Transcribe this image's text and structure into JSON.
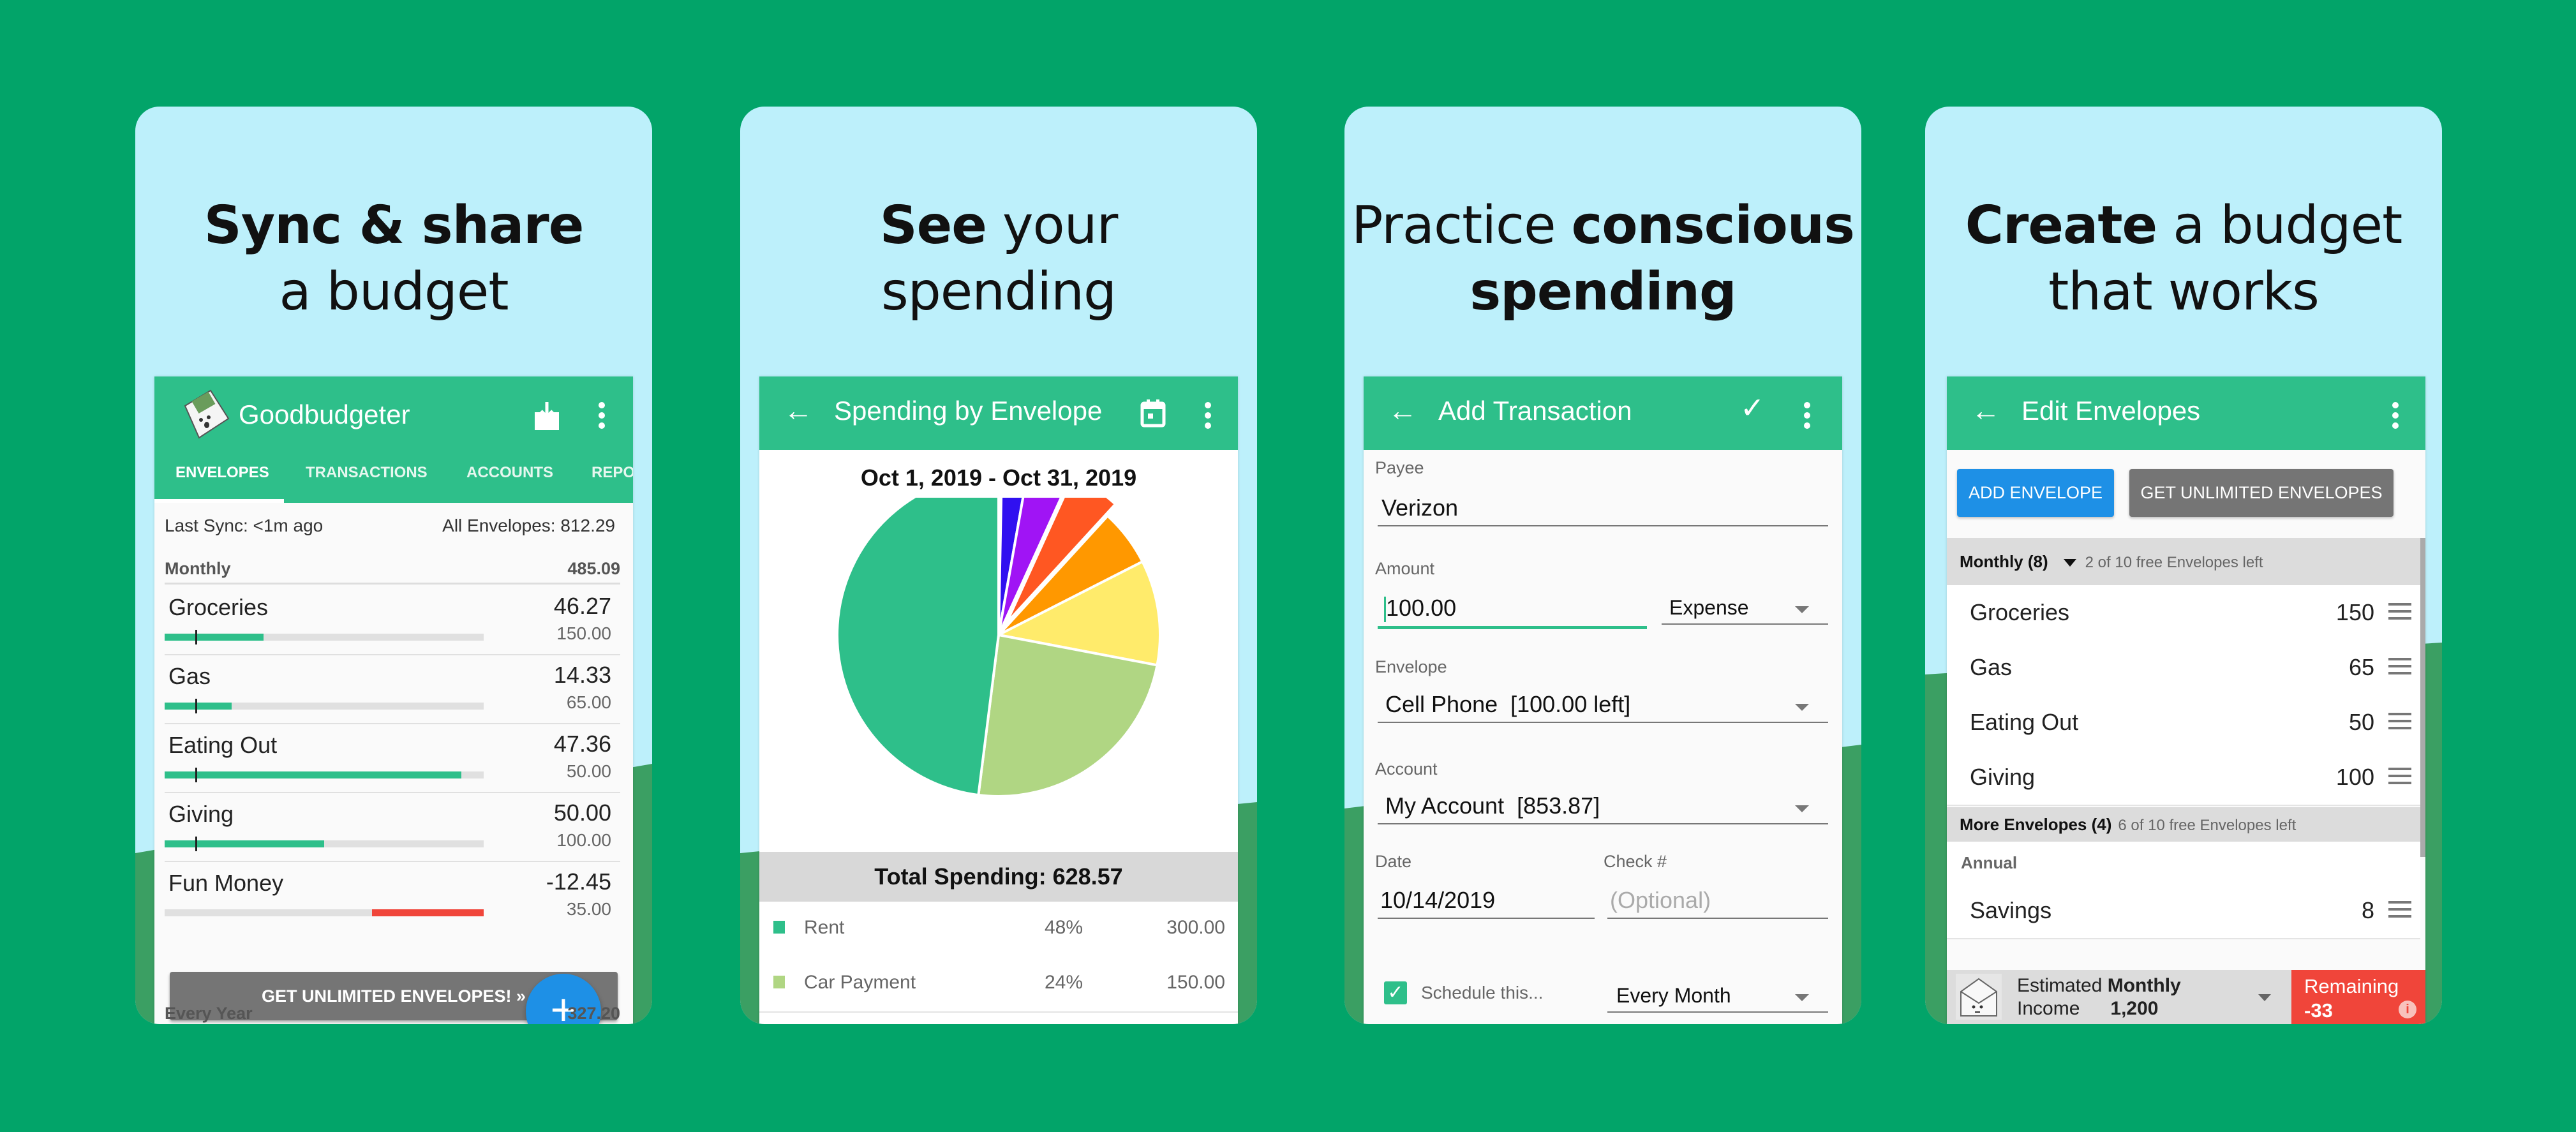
{
  "colors": {
    "background": "#02A469",
    "card_sky": "#BDF0FB",
    "hill": "#3B9F63",
    "app_bar": "#2EBF8A",
    "fab_blue": "#1E90E6",
    "negative_red": "#F0453A",
    "button_gray": "#757575"
  },
  "panels": [
    {
      "headline": {
        "bold": "Sync & share",
        "regular": "a budget"
      },
      "app": {
        "title": "Goodbudgeter",
        "icons": [
          "envelope-logo-icon",
          "download-inbox-icon",
          "more-vert-icon"
        ],
        "tabs": [
          "ENVELOPES",
          "TRANSACTIONS",
          "ACCOUNTS",
          "REPO"
        ],
        "active_tab": "ENVELOPES",
        "last_sync": "Last Sync: <1m ago",
        "all_envelopes": "All Envelopes: 812.29",
        "group": {
          "name": "Monthly",
          "total": "485.09"
        },
        "envelopes": [
          {
            "name": "Groceries",
            "amount": "46.27",
            "budget": "150.00",
            "fill_fraction": 0.31,
            "negative": false
          },
          {
            "name": "Gas",
            "amount": "14.33",
            "budget": "65.00",
            "fill_fraction": 0.21,
            "negative": false
          },
          {
            "name": "Eating Out",
            "amount": "47.36",
            "budget": "50.00",
            "fill_fraction": 0.93,
            "negative": false
          },
          {
            "name": "Giving",
            "amount": "50.00",
            "budget": "100.00",
            "fill_fraction": 0.5,
            "negative": false
          },
          {
            "name": "Fun Money",
            "amount": "-12.45",
            "budget": "35.00",
            "fill_fraction": 0.35,
            "negative": true
          }
        ],
        "unlimited_button": "GET UNLIMITED ENVELOPES! »",
        "fab_label": "+",
        "next_group": {
          "name": "Every Year",
          "total": "327.20"
        }
      }
    },
    {
      "headline": {
        "bold": "See",
        "regular": "your spending"
      },
      "app": {
        "title": "Spending by Envelope",
        "icons": [
          "back-arrow-icon",
          "calendar-icon",
          "more-vert-icon"
        ],
        "back_glyph": "←",
        "date_range": "Oct 1, 2019 - Oct 31, 2019",
        "total_spending": "Total Spending: 628.57",
        "legend": [
          {
            "name": "Rent",
            "pct": "48%",
            "value": "300.00",
            "color": "#2EBF8A"
          },
          {
            "name": "Car Payment",
            "pct": "24%",
            "value": "150.00",
            "color": "#B0D683"
          }
        ]
      }
    },
    {
      "headline": {
        "regular": "Practice",
        "bold": "conscious spending"
      },
      "app": {
        "title": "Add Transaction",
        "back_glyph": "←",
        "check_glyph": "✓",
        "icons": [
          "back-arrow-icon",
          "check-icon",
          "more-vert-icon"
        ],
        "fields": {
          "payee_label": "Payee",
          "payee_value": "Verizon",
          "amount_label": "Amount",
          "amount_value": "100.00",
          "type_value": "Expense",
          "envelope_label": "Envelope",
          "envelope_value": "Cell Phone  [100.00 left]",
          "account_label": "Account",
          "account_value": "My Account  [853.87]",
          "date_label": "Date",
          "date_value": "10/14/2019",
          "check_label": "Check #",
          "check_placeholder": "(Optional)",
          "schedule_label": "Schedule this...",
          "schedule_checked": true,
          "repeat_value": "Every Month"
        }
      }
    },
    {
      "headline": {
        "bold": "Create",
        "regular": "a budget that works"
      },
      "app": {
        "title": "Edit Envelopes",
        "back_glyph": "←",
        "icons": [
          "back-arrow-icon",
          "more-vert-icon"
        ],
        "add_button": "ADD ENVELOPE",
        "unlimited_button": "GET UNLIMITED ENVELOPES",
        "section1": {
          "name": "Monthly (8)",
          "sub": "2 of 10 free Envelopes left"
        },
        "monthly": [
          {
            "name": "Groceries",
            "amount": "150"
          },
          {
            "name": "Gas",
            "amount": "65"
          },
          {
            "name": "Eating Out",
            "amount": "50"
          },
          {
            "name": "Giving",
            "amount": "100"
          }
        ],
        "section2": {
          "name": "More Envelopes (4)",
          "sub": "6 of 10 free Envelopes left"
        },
        "subgroup": "Annual",
        "annual": [
          {
            "name": "Savings",
            "amount": "8"
          }
        ],
        "footer": {
          "estimated": "Estimated",
          "monthly": "Monthly",
          "income": "Income",
          "income_value": "1,200",
          "remaining_label": "Remaining",
          "remaining_value": "-33",
          "info_glyph": "i"
        }
      }
    }
  ],
  "chart_data": {
    "type": "pie",
    "title": "Oct 1, 2019 - Oct 31, 2019",
    "total": 628.57,
    "start": "top",
    "direction": "clockwise",
    "slices": [
      {
        "name": "(unlabeled)",
        "pct": 0.3,
        "color": "#1565C0",
        "exploded": false
      },
      {
        "name": "(unlabeled)",
        "pct": 2.5,
        "color": "#3010F0",
        "exploded": false
      },
      {
        "name": "(unlabeled)",
        "pct": 4.0,
        "color": "#A014F5",
        "exploded": false
      },
      {
        "name": "(unlabeled)",
        "pct": 5.0,
        "color": "#FF5722",
        "exploded": true
      },
      {
        "name": "(unlabeled)",
        "pct": 5.7,
        "color": "#FF9800",
        "exploded": false
      },
      {
        "name": "(unlabeled)",
        "pct": 10.5,
        "color": "#FFEB6B",
        "exploded": false
      },
      {
        "name": "Car Payment",
        "pct": 24,
        "value": 150.0,
        "color": "#B0D683",
        "exploded": false
      },
      {
        "name": "Rent",
        "pct": 48,
        "value": 300.0,
        "color": "#2EBF8A",
        "exploded": false
      }
    ]
  }
}
